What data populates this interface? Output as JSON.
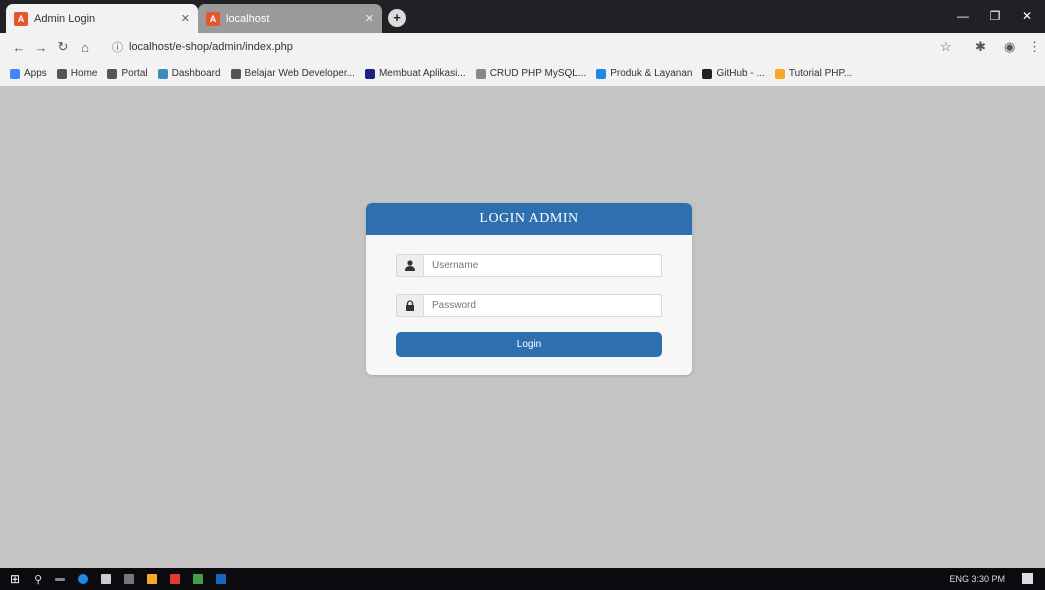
{
  "browser": {
    "tabs": [
      {
        "title": "Admin Login",
        "active": true
      },
      {
        "title": "localhost",
        "active": false
      }
    ],
    "new_tab_icon": "+",
    "window_controls": {
      "minimize": "—",
      "maximize": "❐",
      "close": "✕"
    },
    "url": "localhost/e-shop/admin/index.php",
    "bookmarks": [
      {
        "label": "Apps",
        "color": "#4285f4"
      },
      {
        "label": "Home",
        "color": "#555555"
      },
      {
        "label": "Portal",
        "color": "#555555"
      },
      {
        "label": "Dashboard",
        "color": "#3c8dbc"
      },
      {
        "label": "Belajar Web Developer...",
        "color": "#555555"
      },
      {
        "label": "Membuat Aplikasi...",
        "color": "#1a237e"
      },
      {
        "label": "CRUD PHP MySQL...",
        "color": "#888888"
      },
      {
        "label": "Produk & Layanan",
        "color": "#1e88e5"
      },
      {
        "label": "GitHub - ...",
        "color": "#222222"
      },
      {
        "label": "Tutorial PHP...",
        "color": "#f9a825"
      }
    ]
  },
  "login": {
    "title": "LOGIN ADMIN",
    "username_placeholder": "Username",
    "password_placeholder": "Password",
    "button_label": "Login",
    "accent": "#2e6fb0",
    "user_icon": "user-icon",
    "lock_icon": "lock-icon"
  },
  "taskbar": {
    "tray_text": "ENG 3:30 PM"
  }
}
